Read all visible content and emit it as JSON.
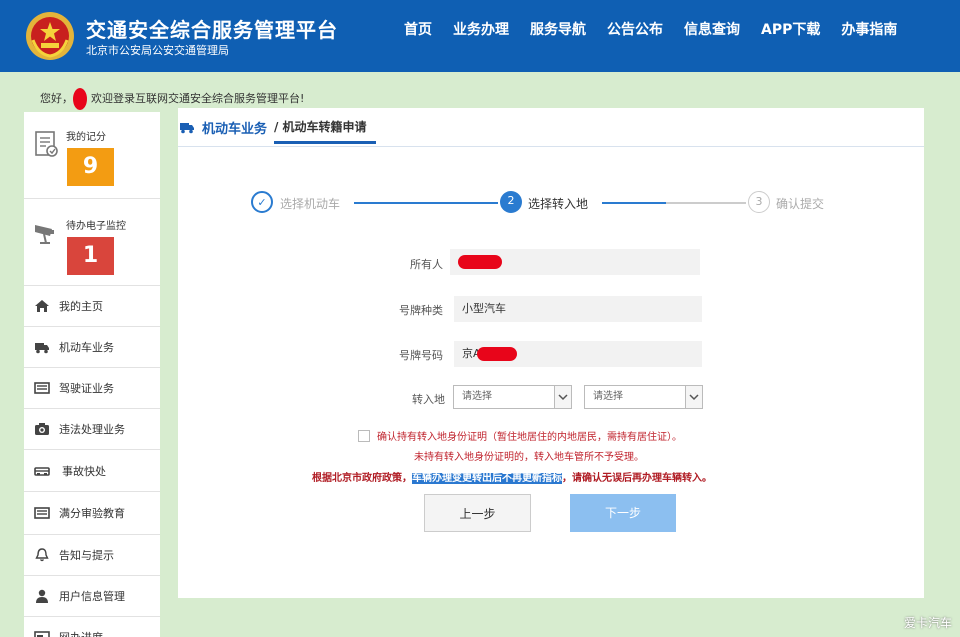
{
  "header": {
    "title": "交通安全综合服务管理平台",
    "subtitle": "北京市公安局公安交通管理局",
    "nav": [
      "首页",
      "业务办理",
      "服务导航",
      "公告公布",
      "信息查询",
      "APP下载",
      "办事指南"
    ]
  },
  "welcome": {
    "prefix": "您好，",
    "text": "欢迎登录互联网交通安全综合服务管理平台!"
  },
  "sidebar": {
    "score": {
      "label": "我的记分",
      "value": "9",
      "color": "#f39c12"
    },
    "monitor": {
      "label": "待办电子监控",
      "value": "1",
      "color": "#d9453c"
    },
    "items": [
      {
        "label": "我的主页",
        "icon": "home-icon"
      },
      {
        "label": "机动车业务",
        "icon": "truck-icon"
      },
      {
        "label": "驾驶证业务",
        "icon": "license-card-icon"
      },
      {
        "label": "违法处理业务",
        "icon": "camera-icon"
      },
      {
        "label": "事故快处",
        "icon": "car-crash-icon"
      },
      {
        "label": "满分审验教育",
        "icon": "book-icon"
      },
      {
        "label": "告知与提示",
        "icon": "bell-icon"
      },
      {
        "label": "用户信息管理",
        "icon": "user-icon"
      },
      {
        "label": "网办进度",
        "icon": "progress-icon"
      }
    ]
  },
  "breadcrumb": {
    "section": "机动车业务",
    "page": "/ 机动车转籍申请"
  },
  "steps": [
    {
      "num": "✓",
      "label": "选择机动车",
      "state": "done"
    },
    {
      "num": "2",
      "label": "选择转入地",
      "state": "active"
    },
    {
      "num": "3",
      "label": "确认提交",
      "state": "pending"
    }
  ],
  "form": {
    "owner_label": "所有人",
    "plate_type_label": "号牌种类",
    "plate_type_value": "小型汽车",
    "plate_number_label": "号牌号码",
    "plate_number_prefix": "京A",
    "destination_label": "转入地",
    "select1_placeholder": "请选择",
    "select2_placeholder": "请选择"
  },
  "notes": {
    "confirm": "确认持有转入地身份证明（暂住地居住的内地居民，需持有居住证）。",
    "warning": "未持有转入地身份证明的，转入地车管所不予受理。",
    "policy_pre": "根据北京市政府政策，",
    "policy_highlight": "车辆办理变更转出后不再更新指标",
    "policy_post": "，请确认无误后再办理车辆转入。"
  },
  "buttons": {
    "prev": "上一步",
    "next": "下一步"
  },
  "watermark": "爱卡汽车",
  "colors": {
    "header_blue": "#0f5fb3",
    "page_bg": "#d7eccf",
    "accent": "#1a5fb4",
    "redaction": "#e8051a",
    "alert_text": "#c0242e"
  }
}
